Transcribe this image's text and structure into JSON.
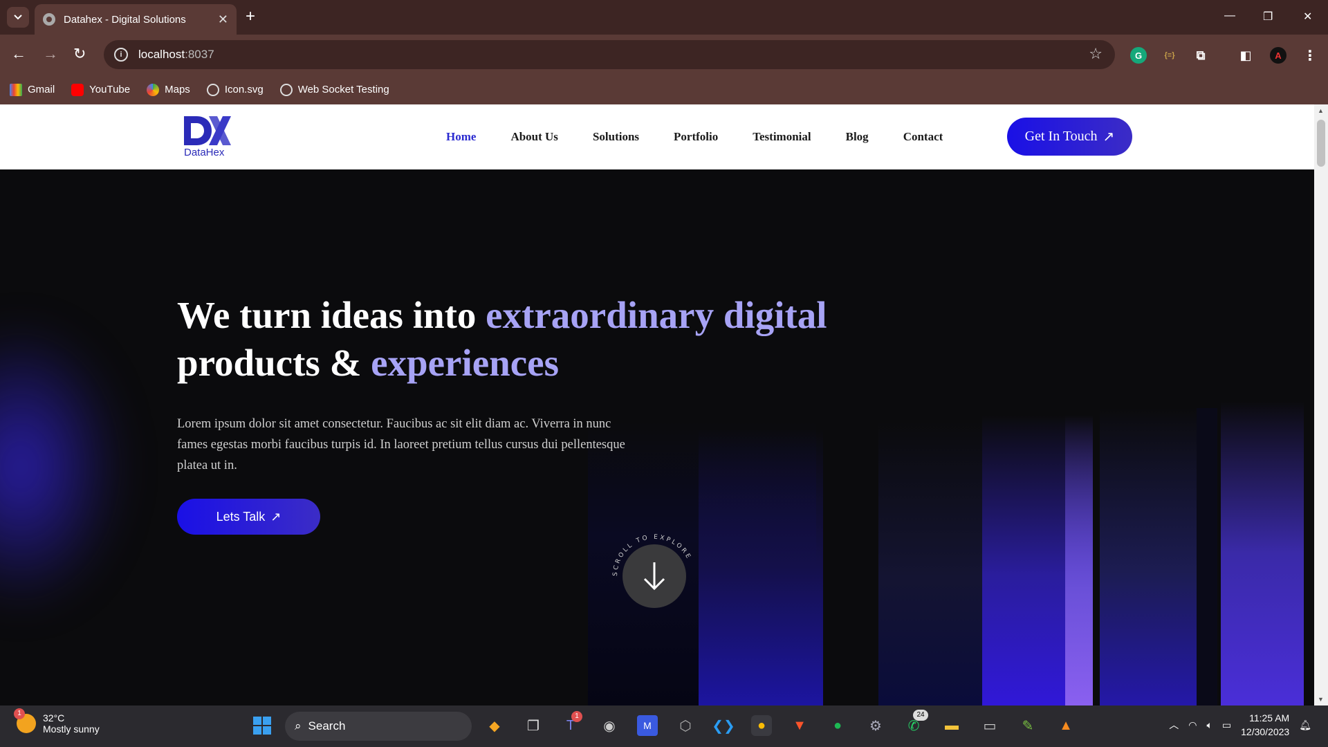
{
  "browser": {
    "tab_title": "Datahex - Digital Solutions",
    "new_tab": "+",
    "url_host": "localhost",
    "url_port": ":8037",
    "bookmarks": [
      {
        "label": "Gmail",
        "icon": "gmail-icon"
      },
      {
        "label": "YouTube",
        "icon": "youtube-icon"
      },
      {
        "label": "Maps",
        "icon": "maps-icon"
      },
      {
        "label": "Icon.svg",
        "icon": "globe-icon"
      },
      {
        "label": "Web Socket Testing",
        "icon": "globe-icon"
      }
    ]
  },
  "site": {
    "brand": "DataHex",
    "nav": [
      "Home",
      "About Us",
      "Solutions",
      "Portfolio",
      "Testimonial",
      "Blog",
      "Contact"
    ],
    "active_nav": "Home",
    "cta": "Get In Touch",
    "hero": {
      "headline_plain": "We turn ideas into",
      "headline_accent": "extraordinary digital",
      "headline_line2_plain": "products &",
      "headline_line2_accent": "experiences",
      "description": "Lorem ipsum dolor sit amet consectetur. Faucibus ac sit elit diam ac. Viverra in nunc fames egestas morbi faucibus turpis id. In laoreet pretium tellus cursus dui pellentesque platea ut in.",
      "button": "Lets Talk",
      "scroll_cue": "SCROLL TO EXPLORE"
    },
    "colors": {
      "accent": "#1a10e6",
      "headline_accent": "#a7a3f5",
      "hero_bg": "#0b0b0d"
    }
  },
  "taskbar": {
    "weather_temp": "32°C",
    "weather_desc": "Mostly sunny",
    "weather_badge": "1",
    "search_label": "Search",
    "teams_badge": "1",
    "whatsapp_badge": "24",
    "time": "11:25 AM",
    "date": "12/30/2023"
  }
}
